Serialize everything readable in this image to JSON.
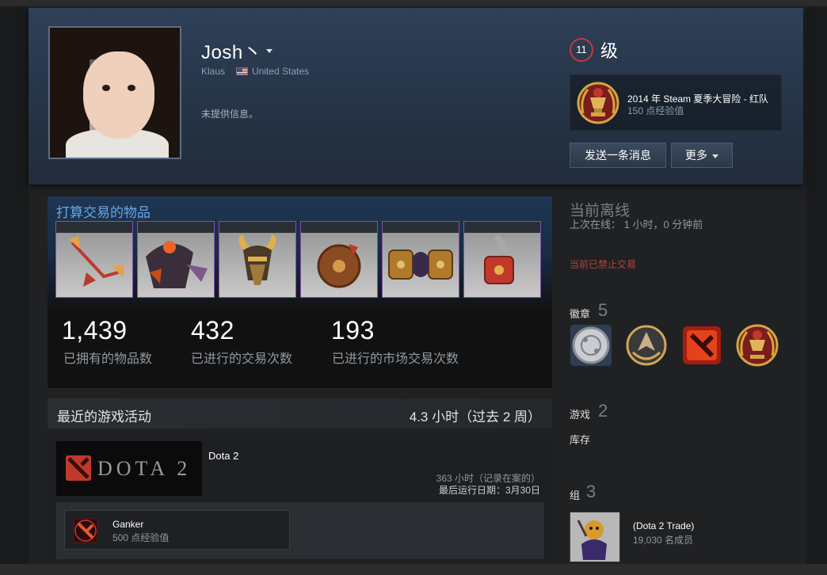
{
  "profile": {
    "name": "Josh丶",
    "real_name": "Klaus",
    "country": "United States",
    "summary": "未提供信息。",
    "level": "11",
    "level_label": "级"
  },
  "featured_badge": {
    "title": "2014 年 Steam 夏季大冒险 - 红队",
    "xp": "150 点经验值"
  },
  "actions": {
    "message_label": "发送一条消息",
    "more_label": "更多"
  },
  "trade_showcase": {
    "title": "打算交易的物品",
    "items": [
      "dota-item-axe-icon",
      "dota-item-armor-icon",
      "dota-item-horned-helm-icon",
      "dota-item-shield-icon",
      "dota-item-bracers-icon",
      "dota-item-gauntlet-icon"
    ],
    "stats": [
      {
        "value": "1,439",
        "label": "已拥有的物品数"
      },
      {
        "value": "432",
        "label": "已进行的交易次数"
      },
      {
        "value": "193",
        "label": "已进行的市场交易次数"
      }
    ]
  },
  "activity": {
    "title": "最近的游戏活动",
    "hours": "4.3 小时（过去 2 周）",
    "game": {
      "logo_text": "DOTA 2",
      "name": "Dota 2",
      "hours_on_record": "363 小时（记录在案的）",
      "last_played": "最后运行日期：3月30日"
    },
    "achievement": {
      "name": "Ganker",
      "xp": "500 点经验值"
    }
  },
  "sidebar": {
    "status": "当前离线",
    "last_online": "上次在线： 1 小时，0 分钟前",
    "trade_ban": "当前已禁止交易",
    "badges_label": "徽章",
    "badges_count": "5",
    "badge_icons": [
      "silver-badge-icon",
      "dota-compendium-badge-icon",
      "dota-red-badge-icon",
      "summer-adventure-badge-icon"
    ],
    "games_label": "游戏",
    "games_count": "2",
    "inventory_label": "库存",
    "groups_label": "组",
    "groups_count": "3",
    "group": {
      "name": "(Dota 2 Trade)",
      "members": "19,030 名成员"
    }
  },
  "colors": {
    "accent_blue": "#66a7e6",
    "level_ring": "#c13a3a",
    "ban_red": "#b8433c",
    "item_border": "#8650ac"
  }
}
